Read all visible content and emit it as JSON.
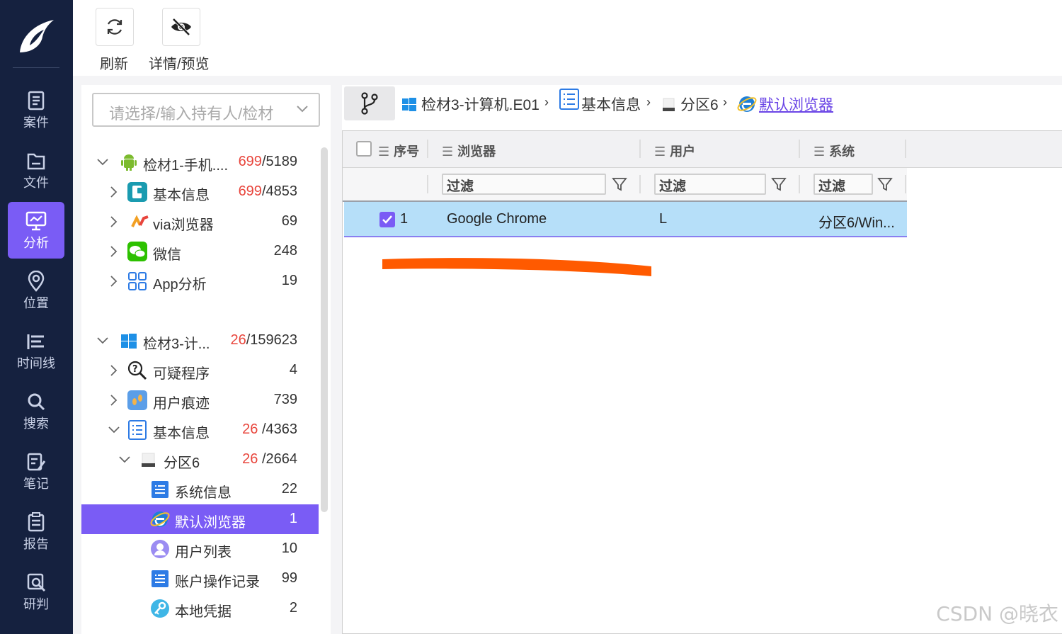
{
  "nav": {
    "items": [
      {
        "label": "案件"
      },
      {
        "label": "文件"
      },
      {
        "label": "分析"
      },
      {
        "label": "位置"
      },
      {
        "label": "时间线"
      },
      {
        "label": "搜索"
      },
      {
        "label": "笔记"
      },
      {
        "label": "报告"
      },
      {
        "label": "研判"
      }
    ],
    "active": "分析"
  },
  "toolbar": {
    "refresh_label": "刷新",
    "detail_label": "详情/预览"
  },
  "tree": {
    "search_placeholder": "请选择/输入持有人/检材",
    "rows": [
      {
        "label": "检材1-手机....",
        "count_red": "699",
        "count_rest": "/5189"
      },
      {
        "label": "基本信息",
        "count_red": "699",
        "count_rest": "/4853"
      },
      {
        "label": "via浏览器",
        "count": "69"
      },
      {
        "label": "微信",
        "count": "248"
      },
      {
        "label": "App分析",
        "count": "19"
      },
      {
        "label": "检材3-计...",
        "count_red": "26",
        "count_rest": "/159623"
      },
      {
        "label": "可疑程序",
        "count": "4"
      },
      {
        "label": "用户痕迹",
        "count": "739"
      },
      {
        "label": "基本信息",
        "count_red": "26",
        "count_rest": " /4363"
      },
      {
        "label": "分区6",
        "count_red": "26",
        "count_rest": " /2664"
      },
      {
        "label": "系统信息",
        "count": "22"
      },
      {
        "label": "默认浏览器",
        "count": "1"
      },
      {
        "label": "用户列表",
        "count": "10"
      },
      {
        "label": "账户操作记录",
        "count": "99"
      },
      {
        "label": "本地凭据",
        "count": "2"
      }
    ]
  },
  "breadcrumb": {
    "items": [
      "检材3-计算机.E01",
      "基本信息",
      "分区6",
      "默认浏览器"
    ]
  },
  "grid": {
    "columns": [
      "序号",
      "浏览器",
      "用户",
      "系统"
    ],
    "filter_placeholder": "过滤",
    "rows": [
      {
        "index": "1",
        "browser": "Google Chrome",
        "user": "L",
        "system": "分区6/Win..."
      }
    ]
  },
  "colors": {
    "nav_bg": "#15213f",
    "accent": "#7a5cf5",
    "selected_row": "#b6dff9",
    "annotation_stroke": "#ff5a00"
  },
  "watermark": "CSDN @晓衣"
}
